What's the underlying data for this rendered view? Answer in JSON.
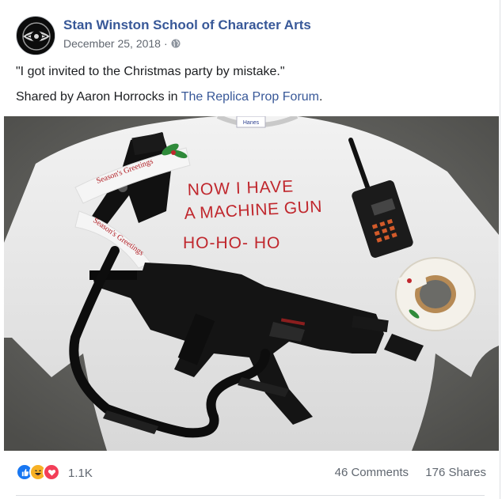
{
  "post": {
    "page_name": "Stan Winston School of Character Arts",
    "date": "December 25, 2018",
    "separator": "·",
    "privacy_icon": "globe-icon",
    "text_line1": "\"I got invited to the Christmas party by mistake.\"",
    "shared_prefix": "Shared by Aaron Horrocks in ",
    "shared_link": "The Replica Prop Forum",
    "shared_suffix": "."
  },
  "photo": {
    "sweater_text": [
      "NOW I HAVE",
      "A MACHINE GUN",
      "HO-HO- HO"
    ],
    "ribbon_text": "Season's Greetings",
    "tag_text": "Hanes"
  },
  "footer": {
    "reactions": [
      "like-icon",
      "haha-icon",
      "love-icon"
    ],
    "reaction_count": "1.1K",
    "comments": "46 Comments",
    "shares": "176 Shares"
  },
  "colors": {
    "link": "#385898",
    "like": "#1877f2",
    "haha": "#f7b125",
    "love": "#f33e58",
    "sweater_text": "#c0272d"
  }
}
